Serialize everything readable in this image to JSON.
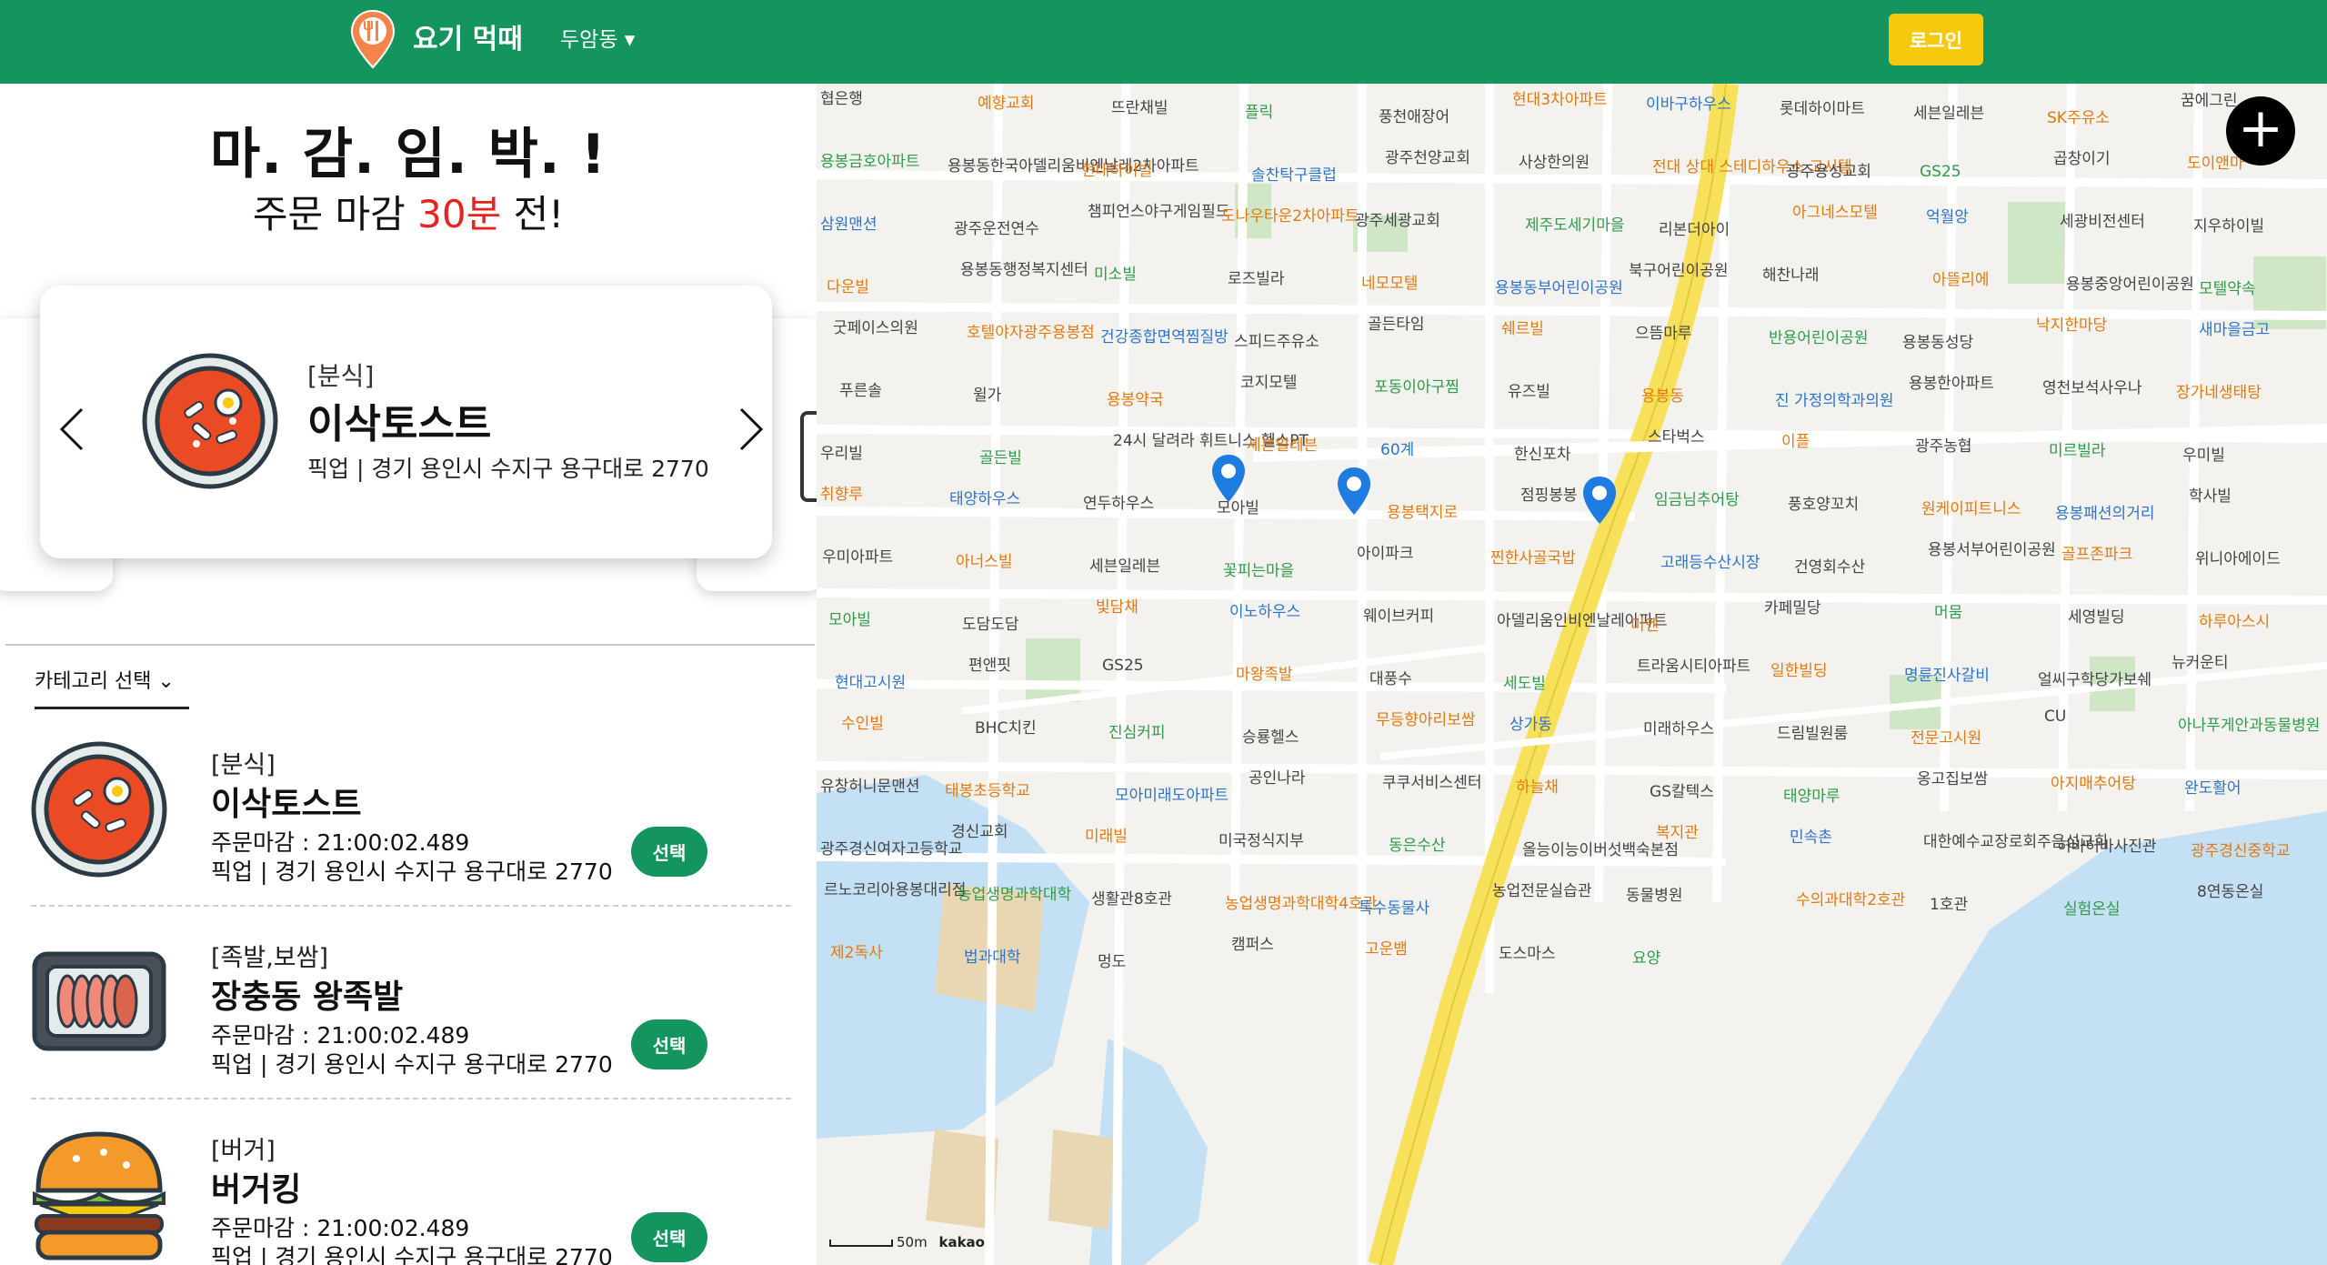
{
  "header": {
    "app_title": "요기 먹때",
    "region": "두암동 ▾",
    "login_label": "로그인",
    "brand_color": "#14945f",
    "login_color": "#f6c90e"
  },
  "banner": {
    "line1": "마. 감. 임. 박. !",
    "line2_prefix": "주문 마감 ",
    "line2_highlight": "30분",
    "line2_suffix": " 전!",
    "highlight_color": "#e8231f"
  },
  "featured": {
    "category": "[분식]",
    "name": "이삭토스트",
    "address": "픽업 | 경기 용인시 수지구 용구대로 2770",
    "icon": "food-bowl-icon"
  },
  "category_select": {
    "label": "카테고리 선택 ⌄"
  },
  "items": [
    {
      "category": "[분식]",
      "name": "이삭토스트",
      "deadline": "주문마감 : 21:00:02.489",
      "address": "픽업 | 경기 용인시 수지구 용구대로 2770",
      "button": "선택",
      "icon": "food-bowl-icon"
    },
    {
      "category": "[족발,보쌈]",
      "name": "장충동 왕족발",
      "deadline": "주문마감 : 21:00:02.489",
      "address": "픽업 | 경기 용인시 수지구 용구대로 2770",
      "button": "선택",
      "icon": "meat-tray-icon"
    },
    {
      "category": "[버거]",
      "name": "버거킹",
      "deadline": "주문마감 : 21:00:02.489",
      "address": "픽업 | 경기 용인시 수지구 용구대로 2770",
      "button": "선택",
      "icon": "burger-icon"
    }
  ],
  "map": {
    "scale_label": "50m",
    "provider": "kakao",
    "plus_label": "+",
    "labels": [
      "협은행",
      "예향교회",
      "뜨란채빌",
      "플릭",
      "풍천애장어",
      "현대3차아파트",
      "이바구하우스",
      "롯데하이마트",
      "세븐일레븐",
      "SK주유소",
      "꿈에그린",
      "용봉금호아파트",
      "용봉동한국아델리움비엔날레2차아파트",
      "현대하이빌",
      "솔찬탁구클럽",
      "광주천양교회",
      "사상한의원",
      "전대 상대 스테디하우스 고시텔",
      "광주용성교회",
      "GS25",
      "곱창이기",
      "도이앤마",
      "삼원맨션",
      "광주운전연수",
      "챔피언스야구게임필드",
      "도나우타운2차아파트",
      "광주세광교회",
      "제주도세기마을",
      "리본더아이",
      "아그네스모텔",
      "억월앙",
      "세광비전센터",
      "지우하이빌",
      "다운빌",
      "용봉동행정복지센터",
      "미소빌",
      "로즈빌라",
      "네모모텔",
      "용봉동부어린이공원",
      "북구어린이공원",
      "해찬나래",
      "아뜰리에",
      "용봉중앙어린이공원",
      "모텔약속",
      "굿페이스의원",
      "호텔야자광주용봉점",
      "건강종합면역찜질방",
      "스피드주유소",
      "골든타임",
      "쉐르빌",
      "으뜸마루",
      "반용어린이공원",
      "용봉동성당",
      "낙지한마당",
      "새마을금고",
      "푸른솔",
      "윌가",
      "용봉약국",
      "코지모텔",
      "포동이아구찜",
      "유즈빌",
      "용봉동",
      "진 가정의학과의원",
      "용봉한아파트",
      "영천보석사우나",
      "장가네생태탕",
      "우리빌",
      "골든빌",
      "24시 달려라 휘트니스 헬스PT",
      "세븐일레븐",
      "60계",
      "한신포차",
      "스타벅스",
      "이플",
      "광주농협",
      "미르빌라",
      "우미빌",
      "취향루",
      "태양하우스",
      "연두하우스",
      "모아빌",
      "용봉택지로",
      "점핑봉봉",
      "임금님추어탕",
      "풍호양꼬치",
      "원케이피트니스",
      "용봉패션의거리",
      "학사빌",
      "우미아파트",
      "아너스빌",
      "세븐일레븐",
      "꽃피는마을",
      "아이파크",
      "찐한사골국밥",
      "고래등수산시장",
      "건영회수산",
      "용봉서부어린이공원",
      "골프존파크",
      "위니아에이드",
      "모아빌",
      "도담도담",
      "빛담채",
      "이노하우스",
      "웨이브커피",
      "아델리움인비엔날레아파트",
      "미엔",
      "카페밀당",
      "머뭄",
      "세영빌딩",
      "하루아스시",
      "현대고시원",
      "편앤핏",
      "GS25",
      "마왕족발",
      "대풍수",
      "세도빌",
      "트라움시티아파트",
      "일한빌딩",
      "명륜진사갈비",
      "얼씨구학당가보쉐",
      "뉴커운티",
      "수인빌",
      "BHC치킨",
      "진심커피",
      "승룡헬스",
      "무등향아리보쌈",
      "상가동",
      "미래하우스",
      "드림빌원룸",
      "전문고시원",
      "CU",
      "아나푸게안과동물병원",
      "유창허니문맨션",
      "태봉초등학교",
      "모아미래도아파트",
      "공인나라",
      "쿠쿠서비스센터",
      "하늘채",
      "GS칼텍스",
      "태양마루",
      "옹고집보쌈",
      "아지매추어탕",
      "완도활어",
      "광주경신여자고등학교",
      "경신교회",
      "미래빌",
      "미국정식지부",
      "동은수산",
      "올능이능이버섯백숙본점",
      "복지관",
      "민속촌",
      "대한예수교장로회주음성교회",
      "허바허바사진관",
      "광주경신중학교",
      "르노코리아용봉대리점",
      "농업생명과학대학",
      "생활관8호관",
      "농업생명과학대학4호관",
      "특수동물사",
      "농업전문실습관",
      "동물병원",
      "수의과대학2호관",
      "1호관",
      "실험온실",
      "8연동온실",
      "제2독사",
      "법과대학",
      "멍도",
      "캠퍼스",
      "고운뱀",
      "도스마스",
      "요양"
    ]
  }
}
